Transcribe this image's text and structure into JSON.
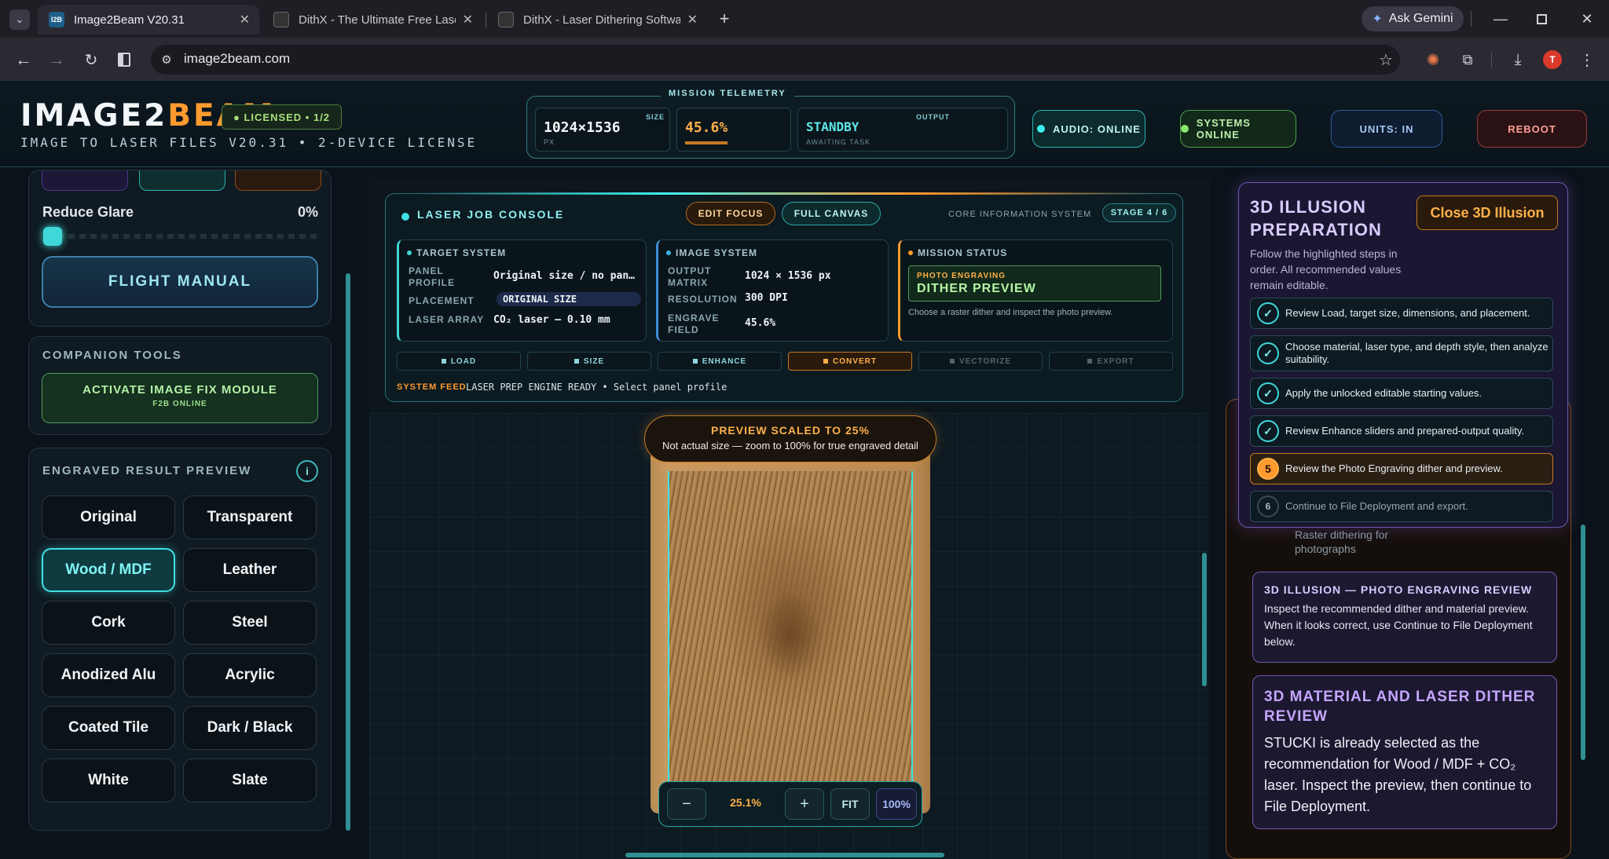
{
  "browser": {
    "tabs": [
      {
        "title": "Image2Beam V20.31",
        "favicon": "I2B"
      },
      {
        "title": "DithX - The Ultimate Free Laser"
      },
      {
        "title": "DithX - Laser Dithering Software"
      }
    ],
    "url": "image2beam.com",
    "gemini": "Ask Gemini",
    "profile_initial": "T"
  },
  "header": {
    "logo_main": "IMAGE2",
    "logo_accent": "BEAM",
    "license": "● LICENSED • 1/2",
    "subtitle": "IMAGE TO LASER FILES V20.31 • 2-DEVICE LICENSE",
    "telemetry": {
      "title": "MISSION TELEMETRY",
      "size_tag": "SIZE",
      "size_value": "1024×1536",
      "size_unit": "PX",
      "field_value": "45.6%",
      "output_tag": "OUTPUT",
      "output_value": "STANDBY",
      "output_sub": "AWAITING TASK"
    },
    "audio": "AUDIO: ONLINE",
    "systems": "SYSTEMS ONLINE",
    "units": "UNITS: IN",
    "reboot": "REBOOT"
  },
  "left": {
    "glare_label": "Reduce Glare",
    "glare_value": "0%",
    "glare_level": 0,
    "flight_manual": "FLIGHT MANUAL",
    "companion_title": "COMPANION TOOLS",
    "activate_main": "ACTIVATE IMAGE FIX MODULE",
    "activate_sub": "F2B ONLINE",
    "preview_title": "ENGRAVED RESULT PREVIEW",
    "info": "i",
    "materials": [
      "Original",
      "Transparent",
      "Wood / MDF",
      "Leather",
      "Cork",
      "Steel",
      "Anodized Alu",
      "Acrylic",
      "Coated Tile",
      "Dark / Black",
      "White",
      "Slate"
    ],
    "selected_material": "Wood / MDF"
  },
  "console": {
    "title": "LASER JOB CONSOLE",
    "edit_focus": "EDIT FOCUS",
    "full_canvas": "FULL CANVAS",
    "core_label": "CORE INFORMATION SYSTEM",
    "stage": "STAGE 4 / 6",
    "target": {
      "title": "TARGET SYSTEM",
      "panel_profile_k": "PANEL PROFILE",
      "panel_profile_v": "Original size / no pan…",
      "placement_k": "PLACEMENT",
      "placement_v": "ORIGINAL SIZE",
      "laser_k": "LASER ARRAY",
      "laser_v": "CO₂ laser — 0.10 mm"
    },
    "image": {
      "title": "IMAGE SYSTEM",
      "matrix_k": "OUTPUT MATRIX",
      "matrix_v": "1024 × 1536 px",
      "res_k": "RESOLUTION",
      "res_v": "300 DPI",
      "field_k": "ENGRAVE FIELD",
      "field_v": "45.6%"
    },
    "mission": {
      "title": "MISSION STATUS",
      "small": "PHOTO ENGRAVING",
      "big": "DITHER PREVIEW",
      "note": "Choose a raster dither and inspect the photo preview."
    },
    "stages": [
      "LOAD",
      "SIZE",
      "ENHANCE",
      "CONVERT",
      "VECTORIZE",
      "EXPORT"
    ],
    "feed_label": "SYSTEM FEED",
    "feed_text": "LASER PREP ENGINE READY • Select panel profile"
  },
  "preview": {
    "banner_title": "PREVIEW SCALED TO 25%",
    "banner_sub": "Not actual size — zoom to 100% for true engraved detail",
    "zoom_minus": "−",
    "zoom_value": "25.1%",
    "zoom_plus": "+",
    "fit": "FIT",
    "full": "100%"
  },
  "right": {
    "title": "3D ILLUSION PREPARATION",
    "close": "Close 3D Illusion",
    "intro": "Follow the highlighted steps in order. All recommended values remain editable.",
    "steps": [
      "Review Load, target size, dimensions, and placement.",
      "Choose material, laser type, and depth style, then analyze suitability.",
      "Apply the unlocked editable starting values.",
      "Review Enhance sliders and prepared-output quality.",
      "Review the Photo Engraving dither and preview.",
      "Continue to File Deployment and export."
    ],
    "step5_num": "5",
    "step6_num": "6",
    "behind_text": "Raster dithering for photographs",
    "review_title": "3D ILLUSION — PHOTO ENGRAVING REVIEW",
    "review_text": "Inspect the recommended dither and material preview. When it looks correct, use Continue to File Deployment below.",
    "material_title": "3D MATERIAL AND LASER DITHER REVIEW",
    "material_text": "STUCKI is already selected as the recommendation for Wood / MDF + CO₂ laser. Inspect the preview, then continue to File Deployment."
  }
}
